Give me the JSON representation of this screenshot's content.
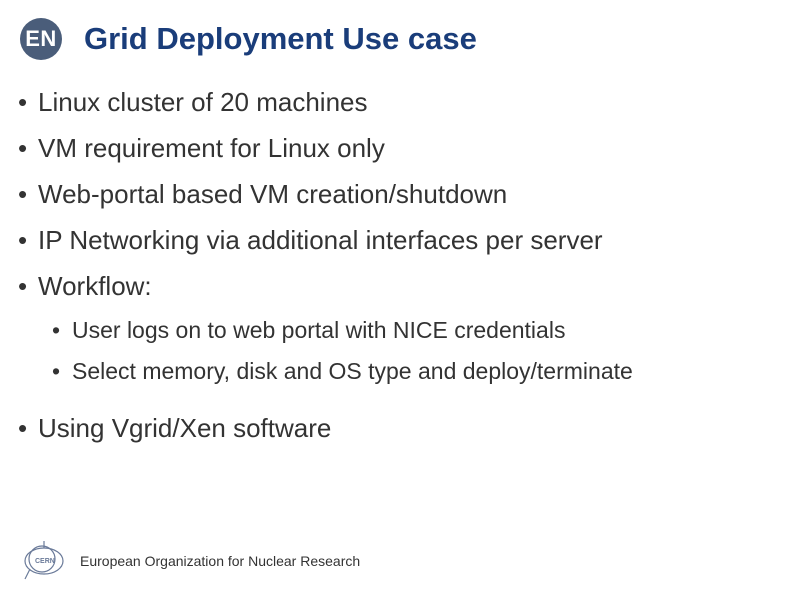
{
  "header": {
    "badge": "EN",
    "title": "Grid Deployment Use case"
  },
  "bullets": [
    {
      "text": "Linux cluster of 20 machines"
    },
    {
      "text": "VM requirement for Linux only"
    },
    {
      "text": "Web-portal based VM creation/shutdown"
    },
    {
      "text": "IP Networking via additional interfaces per server"
    },
    {
      "text": "Workflow:",
      "sub": [
        "User logs on to web portal with NICE credentials",
        "Select memory, disk and OS type and deploy/terminate"
      ]
    },
    {
      "text": "Using Vgrid/Xen software"
    }
  ],
  "footer": {
    "org": "European Organization for Nuclear Research"
  }
}
